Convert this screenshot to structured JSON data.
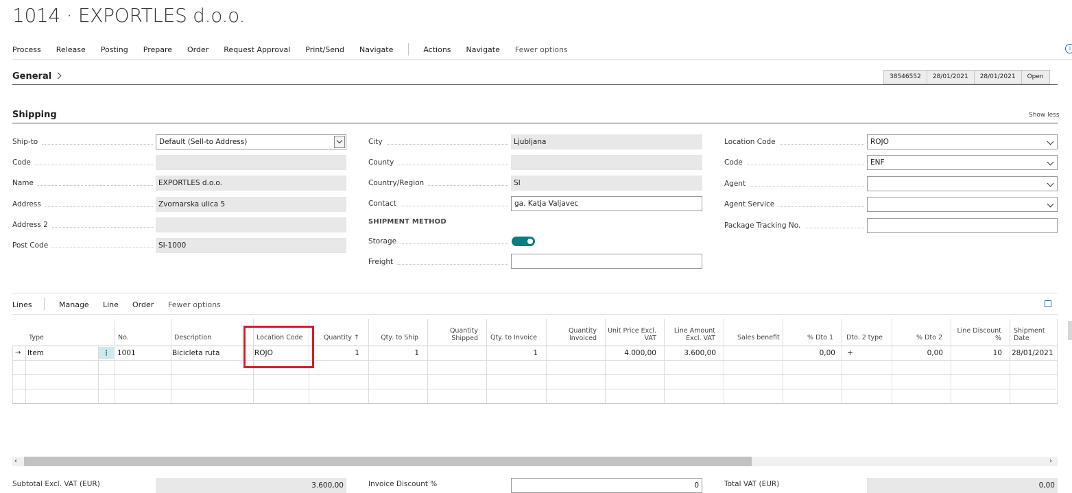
{
  "page": {
    "title": "1014 · EXPORTLES d.o.o."
  },
  "actionbar": {
    "items": [
      "Process",
      "Release",
      "Posting",
      "Prepare",
      "Order",
      "Request Approval",
      "Print/Send",
      "Navigate"
    ],
    "items2": [
      "Actions",
      "Navigate"
    ],
    "fewer": "Fewer options"
  },
  "general": {
    "title": "General",
    "boxes": [
      "38546552",
      "28/01/2021",
      "28/01/2021",
      "Open"
    ]
  },
  "shipping": {
    "title": "Shipping",
    "show_less": "Show less",
    "col1": [
      {
        "label": "Ship-to",
        "value": "Default (Sell-to Address)"
      },
      {
        "label": "Code",
        "value": ""
      },
      {
        "label": "Name",
        "value": "EXPORTLES d.o.o."
      },
      {
        "label": "Address",
        "value": "Zvornarska ulica 5"
      },
      {
        "label": "Address 2",
        "value": ""
      },
      {
        "label": "Post Code",
        "value": "SI-1000"
      }
    ],
    "col2": [
      {
        "label": "City",
        "value": "Ljubljana"
      },
      {
        "label": "County",
        "value": ""
      },
      {
        "label": "Country/Region",
        "value": "SI"
      },
      {
        "label": "Contact",
        "value": "ga. Katja Valjavec"
      }
    ],
    "shipment_method": "SHIPMENT METHOD",
    "storage_label": "Storage",
    "storage_on": true,
    "freight_label": "Freight",
    "freight_value": "",
    "col3": [
      {
        "label": "Location Code",
        "value": "ROJO"
      },
      {
        "label": "Code",
        "value": "ENF"
      },
      {
        "label": "Agent",
        "value": ""
      },
      {
        "label": "Agent Service",
        "value": ""
      },
      {
        "label": "Package Tracking No.",
        "value": ""
      }
    ]
  },
  "lines": {
    "title": "Lines",
    "actions": [
      "Manage",
      "Line",
      "Order",
      "Fewer options"
    ],
    "headers": {
      "type": "Type",
      "no": "No.",
      "description": "Description",
      "location_code": "Location Code",
      "quantity": "Quantity ↑",
      "qty_to_ship": "Qty. to Ship",
      "quantity_shipped": "Quantity Shipped",
      "qty_to_invoice": "Qty. to Invoice",
      "quantity_invoiced": "Quantity Invoiced",
      "unit_price": "Unit Price Excl. VAT",
      "line_amount": "Line Amount Excl. VAT",
      "sales_benefit": "Sales benefit",
      "dto1": "% Dto 1",
      "dto2_type": "Dto. 2 type",
      "dto2": "% Dto 2",
      "line_discount": "Line Discount %",
      "shipment_date": "Shipment Date"
    },
    "rows": [
      {
        "type": "Item",
        "no": "1001",
        "description": "Bicicleta ruta",
        "location_code": "ROJO",
        "quantity": "1",
        "qty_to_ship": "1",
        "quantity_shipped": "",
        "qty_to_invoice": "1",
        "quantity_invoiced": "",
        "unit_price": "4.000,00",
        "line_amount": "3.600,00",
        "sales_benefit": "",
        "dto1": "0,00",
        "dto2_type": "+",
        "dto2": "0,00",
        "line_discount": "10",
        "shipment_date": "28/01/2021"
      }
    ]
  },
  "totals": {
    "subtotal_label": "Subtotal Excl. VAT (EUR)",
    "subtotal_value": "3.600,00",
    "inv_disc_label": "Invoice Discount %",
    "inv_disc_value": "0",
    "total_vat_label": "Total VAT (EUR)",
    "total_vat_value": "0,00"
  },
  "colors": {
    "accent": "#0f7b80",
    "highlight": "#d81d23"
  }
}
